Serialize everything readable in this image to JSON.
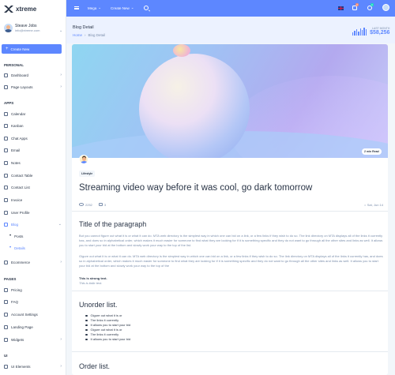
{
  "app": {
    "title": "xtreme"
  },
  "user": {
    "name": "Steave Jobs",
    "email": "info@xtreme.com"
  },
  "sidebar": {
    "create_label": "Create New",
    "sections": {
      "personal": "Personal",
      "apps": "Apps",
      "pages": "Pages",
      "ui": "UI"
    },
    "personal": [
      {
        "label": "Dashboard",
        "icon": "dashboard-icon",
        "chevron": true
      },
      {
        "label": "Page Layouts",
        "icon": "layout-icon",
        "chevron": true
      }
    ],
    "apps": [
      {
        "label": "Calendar",
        "icon": "calendar-icon"
      },
      {
        "label": "Kanban",
        "icon": "kanban-icon"
      },
      {
        "label": "Chat Apps",
        "icon": "chat-icon"
      },
      {
        "label": "Email",
        "icon": "email-icon"
      },
      {
        "label": "Notes",
        "icon": "notes-icon"
      },
      {
        "label": "Contact Table",
        "icon": "contact-icon"
      },
      {
        "label": "Contact List",
        "icon": "contact-list-icon"
      },
      {
        "label": "Invoice",
        "icon": "invoice-icon"
      },
      {
        "label": "User Profile",
        "icon": "user-icon"
      },
      {
        "label": "Blog",
        "icon": "blog-icon",
        "active": true,
        "chevron": true
      }
    ],
    "blog_sub": [
      {
        "label": "Posts"
      },
      {
        "label": "Details",
        "active": true
      }
    ],
    "ecommerce": {
      "label": "Ecommerce",
      "icon": "cart-icon"
    },
    "pages": [
      {
        "label": "Pricing",
        "icon": "pricing-icon"
      },
      {
        "label": "FAQ",
        "icon": "faq-icon"
      },
      {
        "label": "Account Settings",
        "icon": "settings-icon"
      },
      {
        "label": "Landing Page",
        "icon": "landing-icon"
      },
      {
        "label": "Widgets",
        "icon": "widgets-icon",
        "chevron": true
      }
    ],
    "ui": [
      {
        "label": "UI Elements",
        "icon": "ui-icon",
        "chevron": true
      }
    ]
  },
  "topbar": {
    "mega_label": "Mega",
    "create_label": "Create New",
    "cart_count": "2",
    "notif_count": "1"
  },
  "page_header": {
    "title": "Blog Detail",
    "crumbs": [
      "Home",
      "Blog Detail"
    ],
    "stat_label": "LAST MONTH",
    "stat_value": "$58,256"
  },
  "post": {
    "read_time": "2 min Read",
    "tag": "Lifestyle",
    "title": "Streaming video way before it was cool, go dark tomorrow",
    "views": "2252",
    "comments": "3",
    "date": "Sat, Jun 14",
    "h2": "Title of the paragraph",
    "para1": "But you cannot figure out what it is or what it can do. MTA web directory is the simplest way in which one can bid on a link, or a few links if they wish to do so. The link directory on MTA displays all of the links it currently has, and does so in alphabetical order, which makes it much easier for someone to find what they are looking for if it is something specific and they do not want to go through all the other sites and links as well. It allows you to start your bid at the bottom and slowly work your way to the top of the list.",
    "para2": "Gigure out what it is or what it can do. MTA web directory is the simplest way in which one can bid on a link, or a few links if they wish to do so. The link directory on MTA displays all of the links it currently has, and does so in alphabetical order, which makes it much easier for someone to find what they are looking for if it is something specific and they do not want to go through all the other sites and links as well. It allows you to start your bid at the bottom and slowly work your way to the top of the",
    "strong": "This is strong text.",
    "italic": "This is italic text.",
    "ul_title": "Unorder list.",
    "ul_items": [
      "Gigure out what it is or",
      "The links it currently",
      "It allows you to start your bid",
      "Gigure out what it is or",
      "The links it currently",
      "It allows you to start your bid"
    ],
    "ol_title": "Order list."
  }
}
